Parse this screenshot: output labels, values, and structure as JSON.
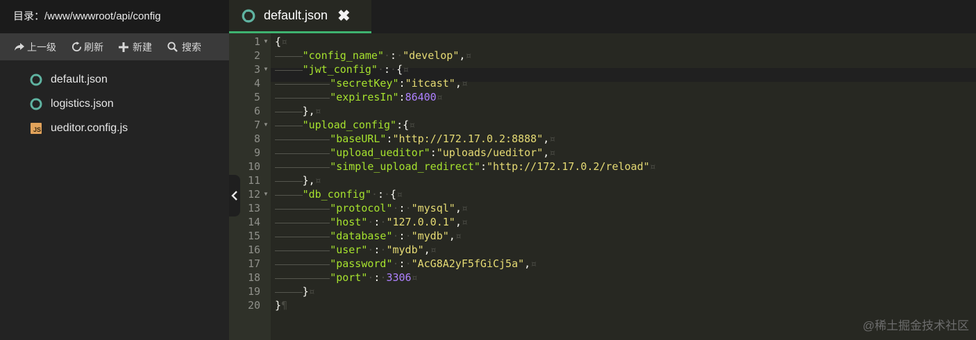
{
  "sidebar": {
    "dir_label": "目录：/www/wwwroot/api/config",
    "toolbar": {
      "up": "上一级",
      "refresh": "刷新",
      "new": "新建",
      "search": "搜索"
    },
    "files": [
      {
        "name": "default.json",
        "icon": "json-icon"
      },
      {
        "name": "logistics.json",
        "icon": "json-icon"
      },
      {
        "name": "ueditor.config.js",
        "icon": "js-file-icon"
      }
    ]
  },
  "editor": {
    "tab": {
      "title": "default.json",
      "close": "✖"
    },
    "line_numbers": [
      "1",
      "2",
      "3",
      "4",
      "5",
      "6",
      "7",
      "8",
      "9",
      "10",
      "11",
      "12",
      "13",
      "14",
      "15",
      "16",
      "17",
      "18",
      "19",
      "20"
    ],
    "lines": [
      [
        {
          "t": "p",
          "v": "{"
        },
        {
          "t": "ws",
          "v": "¤"
        }
      ],
      [
        {
          "t": "i",
          "v": 2
        },
        {
          "t": "k",
          "v": "\"config_name\""
        },
        {
          "t": "ws",
          "v": "·"
        },
        {
          "t": "p",
          "v": ":"
        },
        {
          "t": "ws",
          "v": "·"
        },
        {
          "t": "s",
          "v": "\"develop\""
        },
        {
          "t": "p",
          "v": ","
        },
        {
          "t": "ws",
          "v": "¤"
        }
      ],
      [
        {
          "t": "i",
          "v": 2
        },
        {
          "t": "k",
          "v": "\"jwt_config\""
        },
        {
          "t": "ws",
          "v": "·"
        },
        {
          "t": "p",
          "v": ":"
        },
        {
          "t": "ws",
          "v": "·"
        },
        {
          "t": "p",
          "v": "{"
        },
        {
          "t": "ws",
          "v": "¤"
        }
      ],
      [
        {
          "t": "i",
          "v": 4
        },
        {
          "t": "k",
          "v": "\"secretKey\""
        },
        {
          "t": "p",
          "v": ":"
        },
        {
          "t": "s",
          "v": "\"itcast\""
        },
        {
          "t": "p",
          "v": ","
        },
        {
          "t": "ws",
          "v": "¤"
        }
      ],
      [
        {
          "t": "i",
          "v": 4
        },
        {
          "t": "k",
          "v": "\"expiresIn\""
        },
        {
          "t": "p",
          "v": ":"
        },
        {
          "t": "n",
          "v": "86400"
        },
        {
          "t": "ws",
          "v": "¤"
        }
      ],
      [
        {
          "t": "i",
          "v": 2
        },
        {
          "t": "p",
          "v": "},"
        },
        {
          "t": "ws",
          "v": "¤"
        }
      ],
      [
        {
          "t": "i",
          "v": 2
        },
        {
          "t": "k",
          "v": "\"upload_config\""
        },
        {
          "t": "p",
          "v": ":{"
        },
        {
          "t": "ws",
          "v": "¤"
        }
      ],
      [
        {
          "t": "i",
          "v": 4
        },
        {
          "t": "k",
          "v": "\"baseURL\""
        },
        {
          "t": "p",
          "v": ":"
        },
        {
          "t": "s",
          "v": "\"http://172.17.0.2:8888\""
        },
        {
          "t": "p",
          "v": ","
        },
        {
          "t": "ws",
          "v": "¤"
        }
      ],
      [
        {
          "t": "i",
          "v": 4
        },
        {
          "t": "k",
          "v": "\"upload_ueditor\""
        },
        {
          "t": "p",
          "v": ":"
        },
        {
          "t": "s",
          "v": "\"uploads/ueditor\""
        },
        {
          "t": "p",
          "v": ","
        },
        {
          "t": "ws",
          "v": "¤"
        }
      ],
      [
        {
          "t": "i",
          "v": 4
        },
        {
          "t": "k",
          "v": "\"simple_upload_redirect\""
        },
        {
          "t": "p",
          "v": ":"
        },
        {
          "t": "s",
          "v": "\"http://172.17.0.2/reload\""
        },
        {
          "t": "ws",
          "v": "¤"
        }
      ],
      [
        {
          "t": "i",
          "v": 2
        },
        {
          "t": "p",
          "v": "},"
        },
        {
          "t": "ws",
          "v": "¤"
        }
      ],
      [
        {
          "t": "i",
          "v": 2
        },
        {
          "t": "k",
          "v": "\"db_config\""
        },
        {
          "t": "ws",
          "v": "·"
        },
        {
          "t": "p",
          "v": ":"
        },
        {
          "t": "ws",
          "v": "·"
        },
        {
          "t": "p",
          "v": "{"
        },
        {
          "t": "ws",
          "v": "¤"
        }
      ],
      [
        {
          "t": "i",
          "v": 4
        },
        {
          "t": "k",
          "v": "\"protocol\""
        },
        {
          "t": "ws",
          "v": "·"
        },
        {
          "t": "p",
          "v": ":"
        },
        {
          "t": "ws",
          "v": "·"
        },
        {
          "t": "s",
          "v": "\"mysql\""
        },
        {
          "t": "p",
          "v": ","
        },
        {
          "t": "ws",
          "v": "¤"
        }
      ],
      [
        {
          "t": "i",
          "v": 4
        },
        {
          "t": "k",
          "v": "\"host\""
        },
        {
          "t": "ws",
          "v": "·"
        },
        {
          "t": "p",
          "v": ":"
        },
        {
          "t": "ws",
          "v": "·"
        },
        {
          "t": "s",
          "v": "\"127.0.0.1\""
        },
        {
          "t": "p",
          "v": ","
        },
        {
          "t": "ws",
          "v": "¤"
        }
      ],
      [
        {
          "t": "i",
          "v": 4
        },
        {
          "t": "k",
          "v": "\"database\""
        },
        {
          "t": "ws",
          "v": "·"
        },
        {
          "t": "p",
          "v": ":"
        },
        {
          "t": "ws",
          "v": "·"
        },
        {
          "t": "s",
          "v": "\"mydb\""
        },
        {
          "t": "p",
          "v": ","
        },
        {
          "t": "ws",
          "v": "¤"
        }
      ],
      [
        {
          "t": "i",
          "v": 4
        },
        {
          "t": "k",
          "v": "\"user\""
        },
        {
          "t": "ws",
          "v": "·"
        },
        {
          "t": "p",
          "v": ":"
        },
        {
          "t": "ws",
          "v": "·"
        },
        {
          "t": "s",
          "v": "\"mydb\""
        },
        {
          "t": "p",
          "v": ","
        },
        {
          "t": "ws",
          "v": "¤"
        }
      ],
      [
        {
          "t": "i",
          "v": 4
        },
        {
          "t": "k",
          "v": "\"password\""
        },
        {
          "t": "ws",
          "v": "·"
        },
        {
          "t": "p",
          "v": ":"
        },
        {
          "t": "ws",
          "v": "·"
        },
        {
          "t": "s",
          "v": "\"AcG8A2yF5fGiCj5a\""
        },
        {
          "t": "p",
          "v": ","
        },
        {
          "t": "ws",
          "v": "¤"
        }
      ],
      [
        {
          "t": "i",
          "v": 4
        },
        {
          "t": "k",
          "v": "\"port\""
        },
        {
          "t": "ws",
          "v": "·"
        },
        {
          "t": "p",
          "v": ":"
        },
        {
          "t": "ws",
          "v": "·"
        },
        {
          "t": "n",
          "v": "3306"
        },
        {
          "t": "ws",
          "v": "¤"
        }
      ],
      [
        {
          "t": "i",
          "v": 2
        },
        {
          "t": "p",
          "v": "}"
        },
        {
          "t": "ws",
          "v": "¤"
        }
      ],
      [
        {
          "t": "p",
          "v": "}"
        },
        {
          "t": "ws",
          "v": "¶"
        }
      ]
    ],
    "foldable_lines": [
      1,
      3,
      7,
      12
    ]
  },
  "watermark": "@稀土掘金技术社区"
}
